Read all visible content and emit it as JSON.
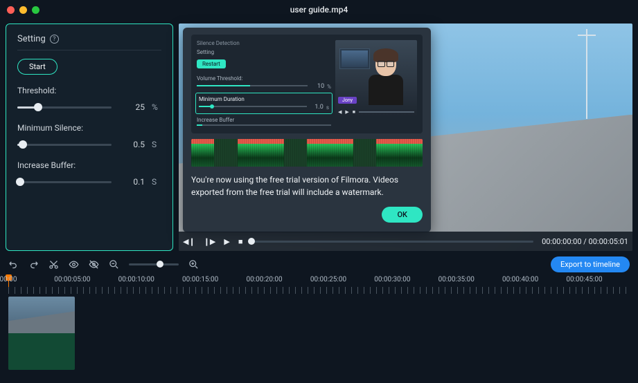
{
  "window": {
    "title": "user guide.mp4"
  },
  "settings": {
    "heading": "Setting",
    "start_label": "Start",
    "threshold_label": "Threshold:",
    "threshold_value": "25",
    "threshold_unit": "%",
    "min_silence_label": "Minimum Silence:",
    "min_silence_value": "0.5",
    "min_silence_unit": "S",
    "buffer_label": "Increase Buffer:",
    "buffer_value": "0.1",
    "buffer_unit": "S"
  },
  "modal": {
    "mini": {
      "title": "Silence Detection",
      "sub": "Setting",
      "restart_label": "Restart",
      "vol_label": "Volume Threshold:",
      "vol_value": "10",
      "vol_unit": "%",
      "dur_label": "Minimum Duration",
      "dur_value": "1.0",
      "dur_unit": "s",
      "buf_label": "Increase Buffer",
      "lowerthird": "Jony"
    },
    "message": "You're now using the free trial version of Filmora. Videos exported from the free trial will include a watermark.",
    "ok_label": "OK"
  },
  "playback": {
    "timecode": "00:00:00:00 / 00:00:05:01"
  },
  "toolbar": {
    "export_label": "Export to timeline"
  },
  "ruler": {
    "labels": [
      "00:00",
      "00:00:05:00",
      "00:00:10:00",
      "00:00:15:00",
      "00:00:20:00",
      "00:00:25:00",
      "00:00:30:00",
      "00:00:35:00",
      "00:00:40:00",
      "00:00:45:00"
    ]
  }
}
